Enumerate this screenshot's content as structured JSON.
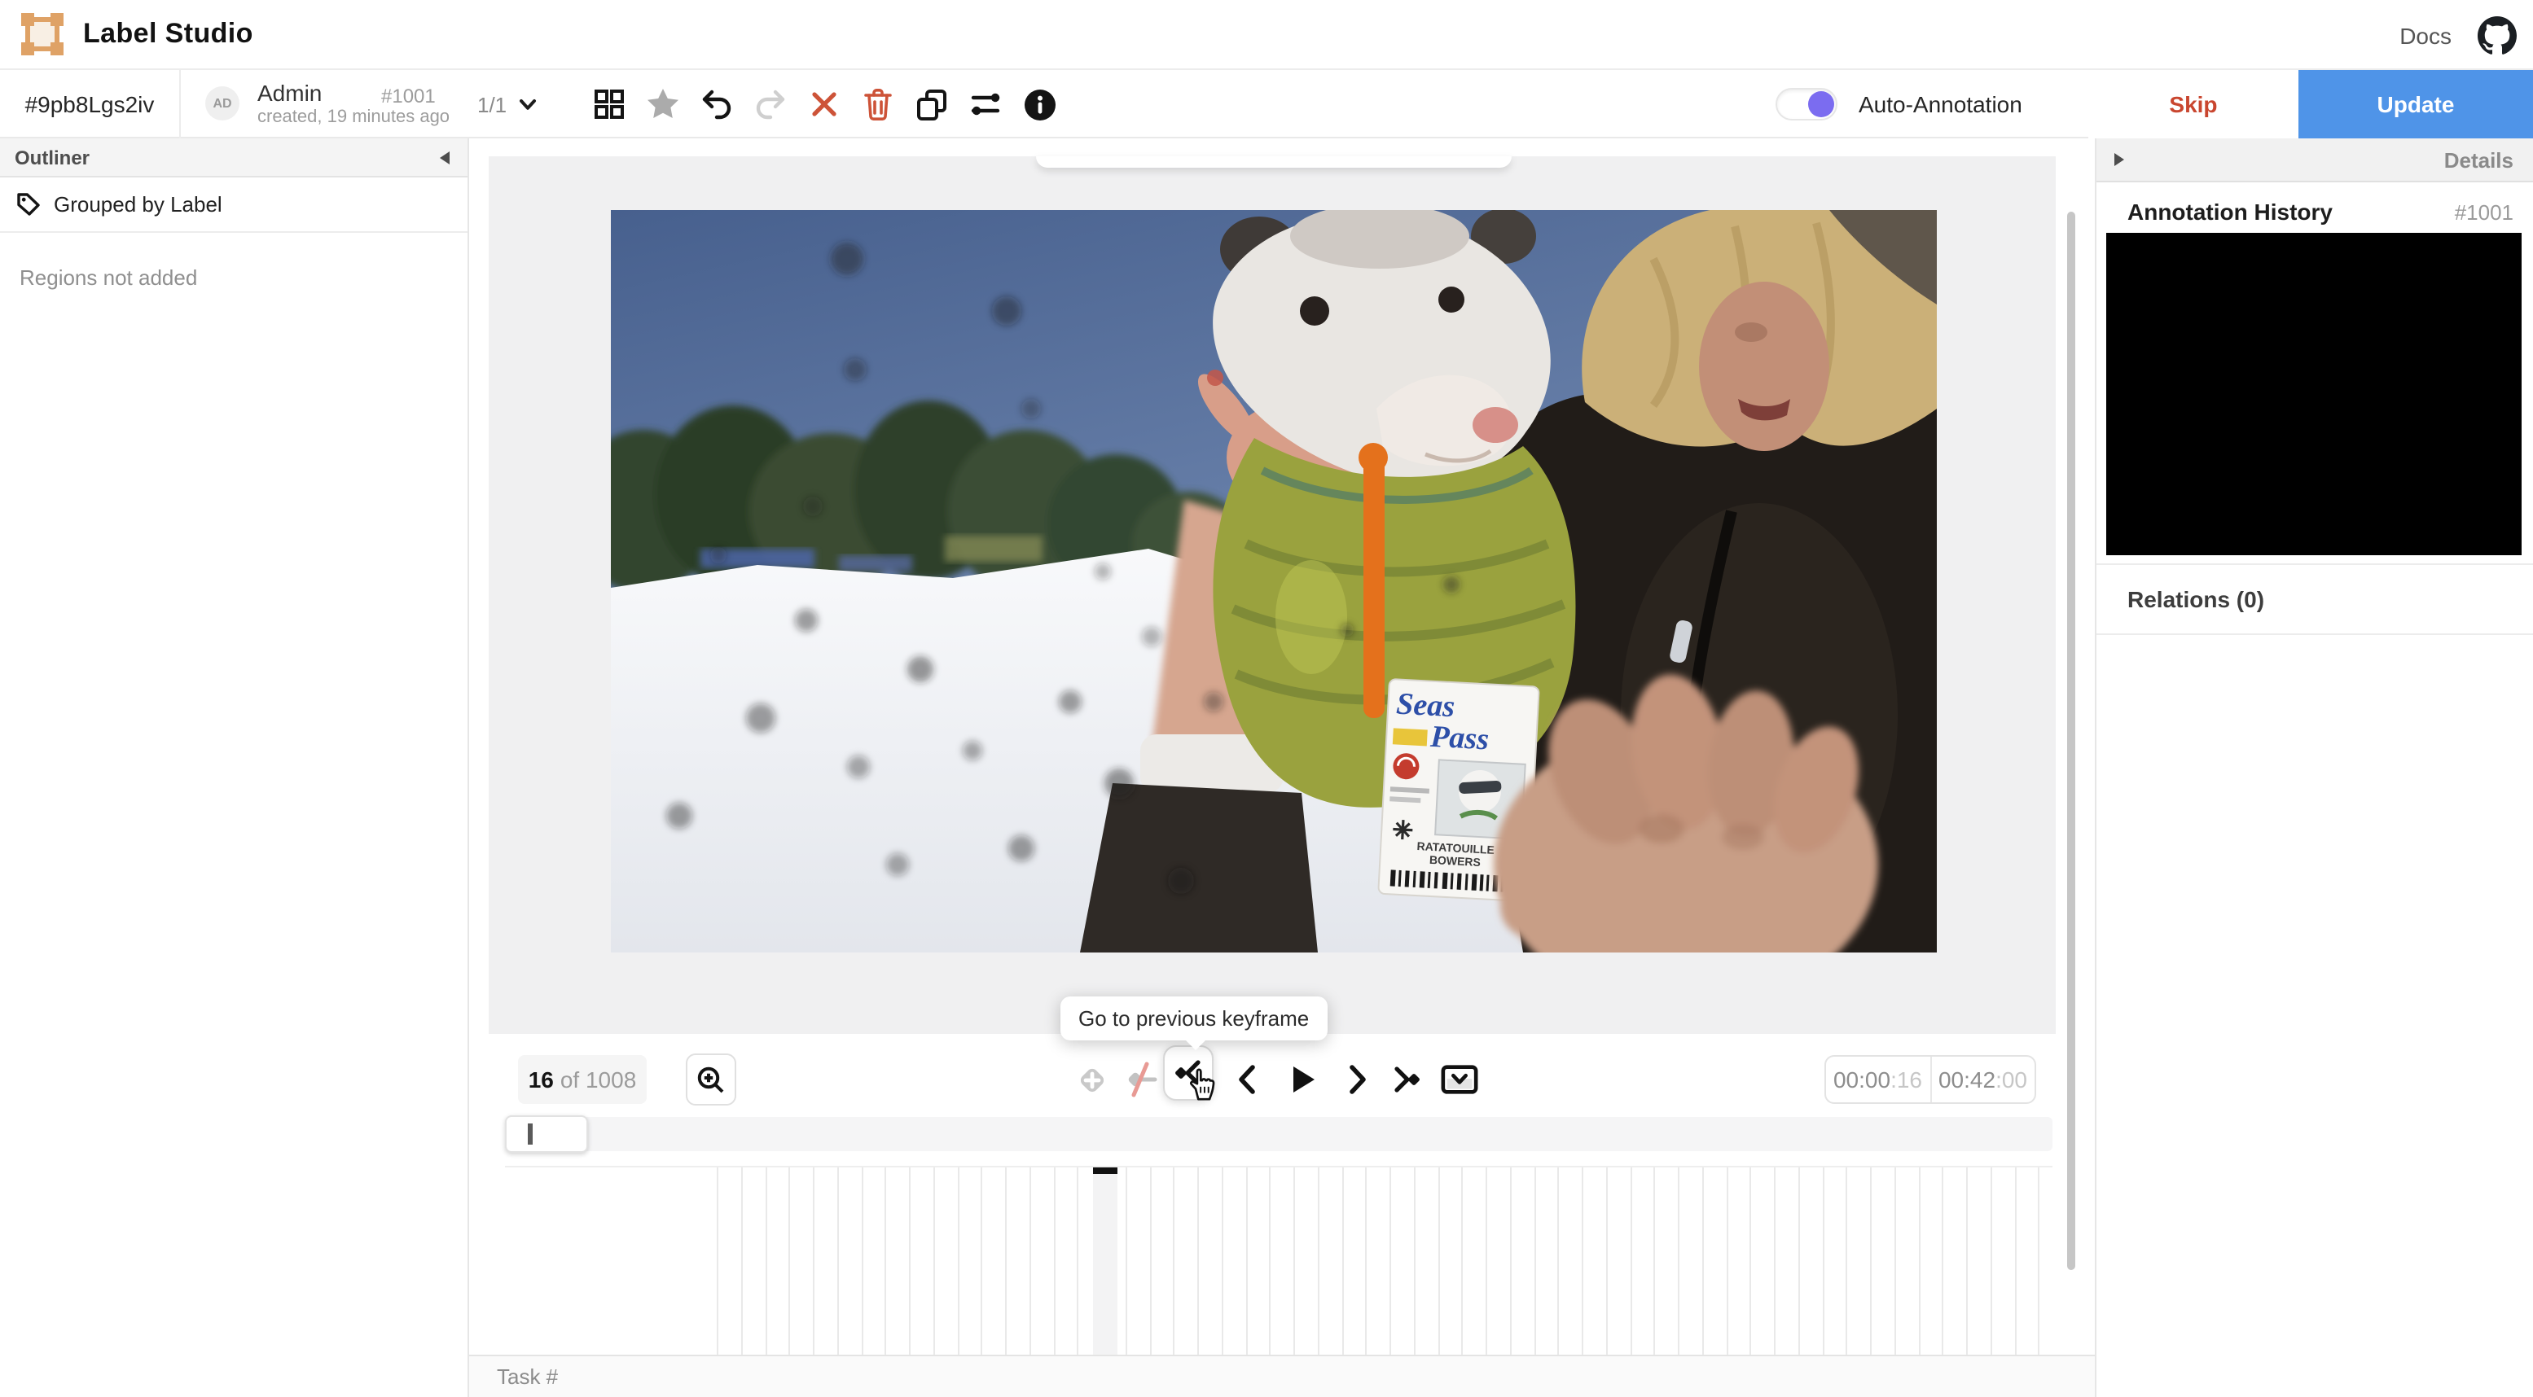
{
  "app": {
    "title": "Label Studio",
    "docs": "Docs"
  },
  "taskbar": {
    "task_id": "#9pb8Lgs2iv",
    "annotator": {
      "initials": "AD",
      "name": "Admin",
      "meta": "created, 19 minutes ago"
    },
    "annotation_id": "#1001",
    "pager": "1/1"
  },
  "actions": {
    "auto_annotation": "Auto-Annotation",
    "skip": "Skip",
    "update": "Update"
  },
  "outliner": {
    "title": "Outliner",
    "view_label": "Grouped by Label",
    "empty_text": "Regions not added"
  },
  "details": {
    "title": "Details",
    "history_title": "Annotation History",
    "annotation_id": "#1001",
    "relations": "Relations (0)"
  },
  "player": {
    "frame_current": "16",
    "frame_total_label": "of 1008",
    "tooltip": "Go to previous keyframe",
    "time_position": "00:00",
    "time_position_frames": ":16",
    "time_duration": "00:42",
    "time_duration_frames": ":00"
  },
  "footer": {
    "task_label": "Task #"
  },
  "video_alt": "GoPro frame: person in dark jacket holding an opossum in a green knit sweater with orange strap and Season Pass badge, snowy ski slope and pine trees behind",
  "icons": {
    "logo": "bounding-box-corners",
    "github": "github-octocat",
    "grid": "view-all-grid",
    "star": "ground-truth-star",
    "undo": "undo-arrow",
    "redo": "redo-arrow",
    "reject": "cross",
    "delete": "trash",
    "copy": "duplicate",
    "settings": "slider-lines",
    "info": "info-circle",
    "collapse_left": "triangle-left",
    "expand_right": "triangle-right",
    "tag": "label-tag",
    "zoom_in": "magnifier-plus",
    "keyframe_add": "diamond-plus",
    "keyframe_toggle": "diamond-slash",
    "keyframe_prev": "diamond-chevron-left",
    "frame_prev": "chevron-left",
    "play": "play-triangle",
    "frame_next": "chevron-right",
    "keyframe_next": "chevron-right-diamond",
    "timeline_collapse": "box-chevron-down",
    "pager_chevron": "chevron-down",
    "cursor": "hand-pointer"
  },
  "colors": {
    "accent_blue": "#4f94e8",
    "skip_red": "#c9462f",
    "danger": "#cd5338",
    "toggle_purple": "#7b6cf0",
    "logo_orange": "#dfa266",
    "star_gray": "#ababab"
  }
}
